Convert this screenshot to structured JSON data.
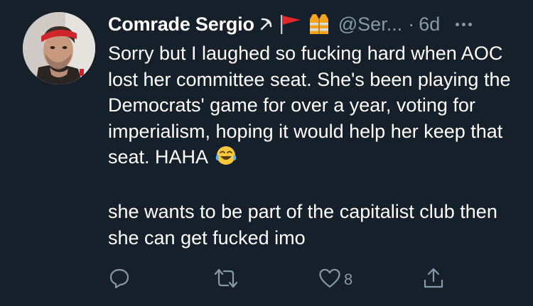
{
  "tweet": {
    "display_name": "Comrade Sergio",
    "name_emojis": [
      {
        "icon": "hammer-and-sickle-icon",
        "glyph": "☭"
      },
      {
        "icon": "red-flag-icon",
        "glyph": "🚩"
      },
      {
        "icon": "safety-vest-icon",
        "glyph": "🦺"
      }
    ],
    "handle": "@Ser...",
    "separator": "·",
    "timestamp": "6d",
    "body_paragraph_1": "Sorry but I laughed so fucking hard when AOC lost her committee seat. She's been playing the Democrats' game for over a year, voting for imperialism, hoping it would help her keep that seat. HAHA",
    "body_emoji": {
      "icon": "face-with-tears-of-joy-icon",
      "glyph": "😂"
    },
    "body_paragraph_2": "she wants to be part of the capitalist club then she can get fucked imo"
  },
  "actions": {
    "reply": {
      "icon": "reply-icon",
      "count": ""
    },
    "retweet": {
      "icon": "retweet-icon",
      "count": ""
    },
    "like": {
      "icon": "heart-icon",
      "count": "8"
    },
    "share": {
      "icon": "share-icon",
      "count": ""
    }
  },
  "colors": {
    "background": "#15202b",
    "primary_text": "#ffffff",
    "secondary_text": "#8899a6",
    "flag_red": "#e0282c",
    "vest_orange": "#f4a31c"
  }
}
